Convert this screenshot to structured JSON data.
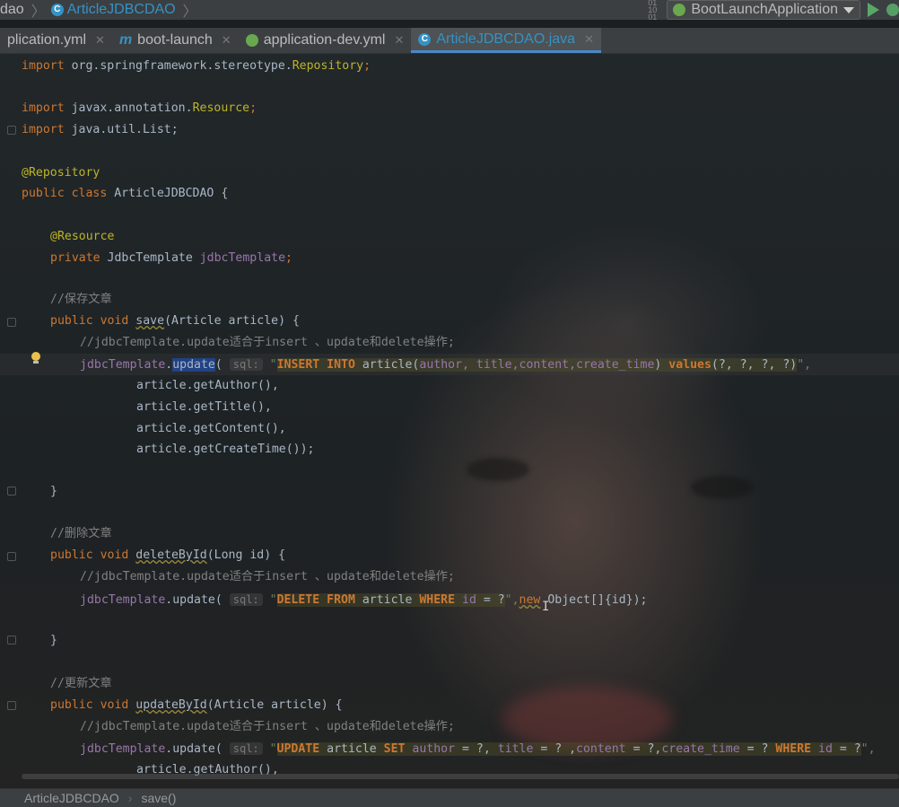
{
  "navbar": {
    "crumbs": [
      "dao",
      "ArticleJDBCDAO"
    ],
    "run_config": "BootLaunchApplication"
  },
  "tabs": [
    {
      "label": "plication.yml",
      "icon": "yml-icon",
      "active": false
    },
    {
      "label": "boot-launch",
      "icon": "maven-m-icon",
      "active": false
    },
    {
      "label": "application-dev.yml",
      "icon": "spring-yml-icon",
      "active": false
    },
    {
      "label": "ArticleJDBCDAO.java",
      "icon": "class-icon",
      "active": true
    }
  ],
  "code": {
    "l1_kw": "import",
    "l1_rest": " org.springframework.stereotype.",
    "l1_cls": "Repository",
    "l1_end": ";",
    "l3_kw": "import",
    "l3_rest": " javax.annotation.",
    "l3_cls": "Resource",
    "l3_end": ";",
    "l4_kw": "import",
    "l4_rest": " java.util.List;",
    "l6_ann": "@Repository",
    "l7_kw": "public class",
    "l7_rest": " ArticleJDBCDAO {",
    "l9_ann": "@Resource",
    "l10_kw": "private",
    "l10_type": " JdbcTemplate ",
    "l10_fld": "jdbcTemplate",
    "l10_end": ";",
    "l12_cm": "//保存文章",
    "l13_kw": "public void",
    "l13_name": "save",
    "l13_rest": "(Article article) {",
    "l14_cm": "//jdbcTemplate.update适合于insert 、update和delete操作;",
    "l15_fld": "jdbcTemplate",
    "l15_dot": ".",
    "l15_call": "update",
    "l15_paren": "( ",
    "l15_hint": "sql:",
    "l15_q1": " \"",
    "l15_k1": "INSERT INTO",
    "l15_t1": " article(",
    "l15_f1": "author, title,content,create_time",
    "l15_t2": ") ",
    "l15_k2": "values",
    "l15_t3": "(?, ?, ?, ?)",
    "l15_q2": "\",",
    "l16": "article.getAuthor(),",
    "l17": "article.getTitle(),",
    "l18": "article.getContent(),",
    "l19": "article.getCreateTime());",
    "l21": "}",
    "l23_cm": "//删除文章",
    "l24_kw": "public void",
    "l24_name": "deleteById",
    "l24_rest": "(Long id) {",
    "l25_cm": "//jdbcTemplate.update适合于insert 、update和delete操作;",
    "l26_fld": "jdbcTemplate",
    "l26_call": ".update( ",
    "l26_hint": "sql:",
    "l26_q1": " \"",
    "l26_k1": "DELETE FROM",
    "l26_t1": " article ",
    "l26_k2": "WHERE",
    "l26_f1": " id",
    "l26_t2": " = ?",
    "l26_q2": "\",",
    "l26_kw": "new",
    "l26_rest": " Object[]{id});",
    "l28": "}",
    "l30_cm": "//更新文章",
    "l31_kw": "public void",
    "l31_name": "updateById",
    "l31_rest": "(Article article) {",
    "l32_cm": "//jdbcTemplate.update适合于insert 、update和delete操作;",
    "l33_fld": "jdbcTemplate",
    "l33_call": ".update( ",
    "l33_hint": "sql:",
    "l33_q1": " \"",
    "l33_k1": "UPDATE",
    "l33_t1": " article ",
    "l33_k2": "SET",
    "l33_f1": " author",
    "l33_t2": " = ?, ",
    "l33_f2": "title",
    "l33_t3": " = ? ,",
    "l33_f3": "content",
    "l33_t4": " = ?,",
    "l33_f4": "create_time",
    "l33_t5": " = ? ",
    "l33_k3": "WHERE",
    "l33_f5": " id",
    "l33_t6": " = ?",
    "l33_q2": "\",",
    "l34": "article.getAuthor(),"
  },
  "statusbar": {
    "class_name": "ArticleJDBCDAO",
    "method": "save()"
  }
}
